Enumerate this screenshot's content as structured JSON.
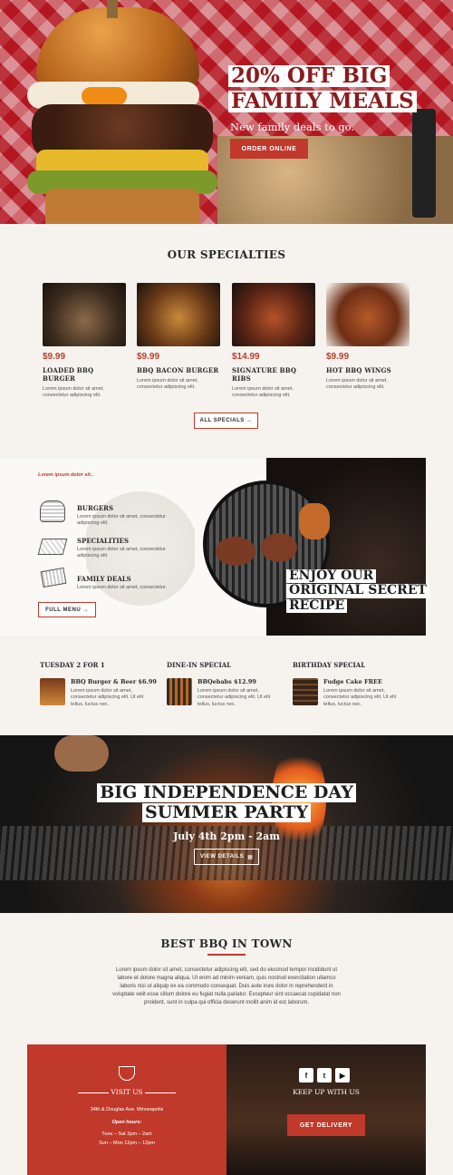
{
  "hero": {
    "headline_line1": "20% OFF BIG",
    "headline_line2": "FAMILY MEALS",
    "subtitle": "New family deals to go.",
    "cta": "ORDER ONLINE"
  },
  "specialties": {
    "heading": "OUR SPECIALTIES",
    "items": [
      {
        "price": "$9.99",
        "name": "LOADED BBQ BURGER",
        "desc": "Lorem ipsum dolor sit amet, consectetur adipiscing elit."
      },
      {
        "price": "$9.99",
        "name": "BBQ BACON BURGER",
        "desc": "Lorem ipsum dolor sit amet, consectetur adipiscing elit."
      },
      {
        "price": "$14.99",
        "name": "SIGNATURE BBQ RIBS",
        "desc": "Lorem ipsum dolor sit amet, consectetur adipiscing elit."
      },
      {
        "price": "$9.99",
        "name": "HOT BBQ WINGS",
        "desc": "Lorem ipsum dolor sit amet, consectetur adipiscing elit."
      }
    ],
    "all_button": "ALL SPECIALS →"
  },
  "menu_panel": {
    "kicker": "Lorem ipsum dolor sit..",
    "items": [
      {
        "title": "BURGERS",
        "desc": "Lorem ipsum dolor sit amet, consectetur adipiscing elit."
      },
      {
        "title": "SPECIALITIES",
        "desc": "Lorem ipsum dolor sit amet, consectetur adipiscing elit."
      },
      {
        "title": "FAMILY DEALS",
        "desc": "Lorem ipsum dolor sit amet, consectetur."
      }
    ],
    "full_menu": "FULL MENU →",
    "recipe_line1": "ENJOY OUR",
    "recipe_line2": "ORIGINAL SECRET",
    "recipe_line3": "RECIPE"
  },
  "daily": [
    {
      "heading": "TUESDAY 2 FOR 1",
      "item": "BBQ Burger & Beer $6.99",
      "desc": "Lorem ipsum dolor sit amet, consectetur adipiscing elit. Ut elit tellus, luctus nec."
    },
    {
      "heading": "DINE-IN SPECIAL",
      "item": "BBQebabs $12.99",
      "desc": "Lorem ipsum dolor sit amet, consectetur adipiscing elit. Ut elit tellus, luctus nec."
    },
    {
      "heading": "BIRTHDAY SPECIAL",
      "item": "Fudge Cake FREE",
      "desc": "Lorem ipsum dolor sit amet, consectetur adipiscing elit. Ut elit tellus, luctus nec."
    }
  ],
  "party": {
    "line1": "BIG INDEPENDENCE DAY",
    "line2": "SUMMER PARTY",
    "when": "July 4th 2pm - 2am",
    "button": "VIEW DETAILS"
  },
  "best": {
    "heading": "BEST BBQ IN TOWN",
    "body": "Lorem ipsum dolor sit amet, consectetur adipiscing elit, sed do eiusmod tempor incididunt ut labore et dolore magna aliqua. Ut enim ad minim veniam, quis nostrud exercitation ullamco laboris nisi ut aliquip ex ea commodo consequat. Duis aute irure dolor in reprehenderit in voluptate velit esse cillum dolore eu fugiat nulla pariatur. Excepteur sint occaecat cupidatat non proident, sunt in culpa qui officia deserunt mollit anim id est laborum."
  },
  "visit": {
    "heading": "VISIT US",
    "address": "34th & Douglas Ave. Minneapolis",
    "hours_label": "Open hours:",
    "hours1": "Tues – Sat  2pm – 2am",
    "hours2": "Sun –  Mon 12pm – 12pm"
  },
  "keep": {
    "heading": "KEEP UP WITH US",
    "delivery": "GET DELIVERY",
    "social": [
      "f",
      "t",
      "▶"
    ]
  },
  "colors": {
    "accent": "#c0392b",
    "dark": "#1d1d1d",
    "bg": "#f6f3ef"
  }
}
